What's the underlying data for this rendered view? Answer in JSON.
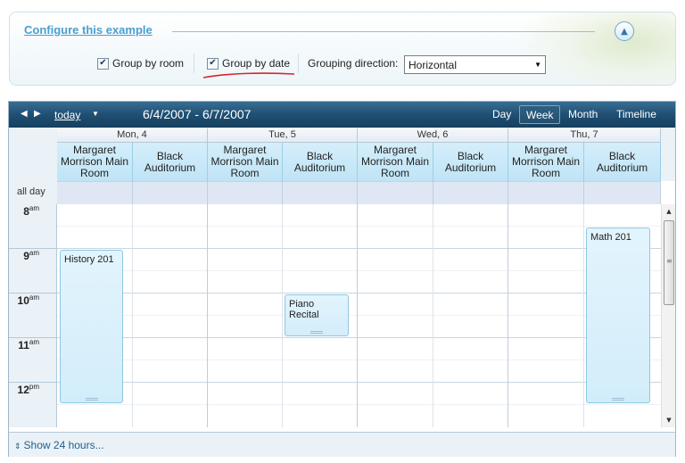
{
  "config": {
    "title": "Configure this example",
    "group_by_room": {
      "label": "Group by room",
      "checked": true
    },
    "group_by_date": {
      "label": "Group by date",
      "checked": true
    },
    "grouping_direction_label": "Grouping direction:",
    "grouping_direction_value": "Horizontal"
  },
  "toolbar": {
    "prev_icon": "◀",
    "next_icon": "▶",
    "today_label": "today",
    "date_range": "6/4/2007 - 6/7/2007",
    "views": [
      "Day",
      "Week",
      "Month",
      "Timeline"
    ],
    "active_view": "Week"
  },
  "days": [
    {
      "label": "Mon, 4"
    },
    {
      "label": "Tue, 5"
    },
    {
      "label": "Wed, 6"
    },
    {
      "label": "Thu, 7"
    }
  ],
  "rooms": [
    "Margaret Morrison Main Room",
    "Black Auditorium"
  ],
  "allday_label": "all day",
  "hours": [
    {
      "h": "8",
      "ampm": "am"
    },
    {
      "h": "9",
      "ampm": "am"
    },
    {
      "h": "10",
      "ampm": "am"
    },
    {
      "h": "11",
      "ampm": "am"
    },
    {
      "h": "12",
      "ampm": "pm"
    }
  ],
  "appointments": [
    {
      "title": "History 201"
    },
    {
      "title": "Piano Recital"
    },
    {
      "title": "Math 201"
    }
  ],
  "footer": {
    "show_24": "Show 24 hours..."
  },
  "colors": {
    "toolbar": "#1f4f73",
    "resource_header": "#c8e8f8",
    "appointment": "#d8effb",
    "annotation_red": "#d9262c"
  }
}
